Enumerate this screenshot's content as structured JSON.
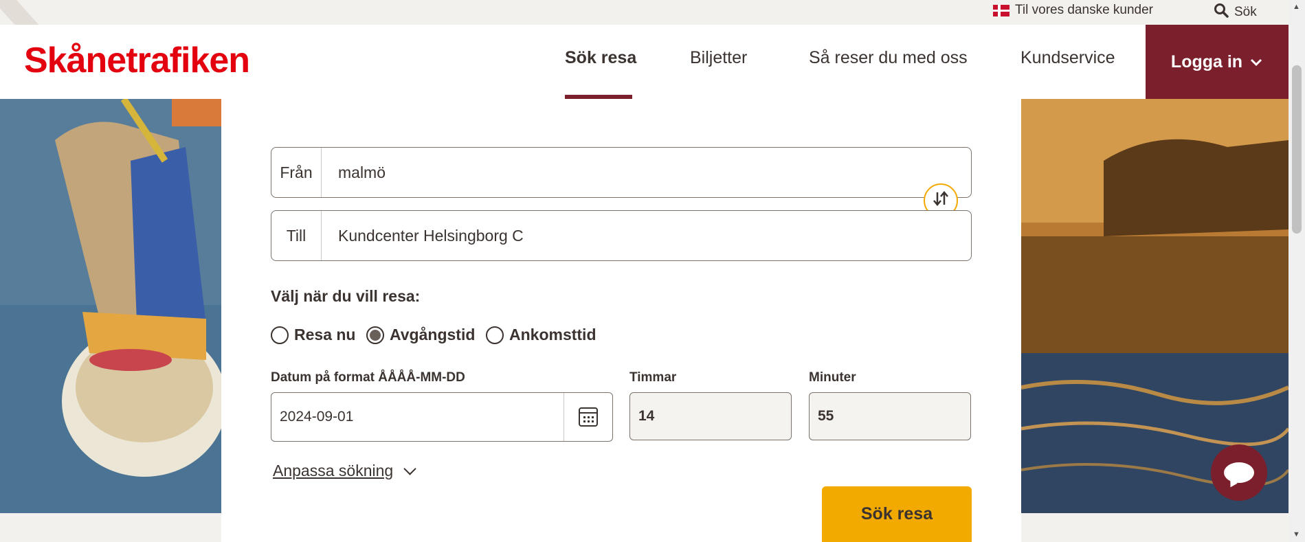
{
  "utility_bar": {
    "danish_customers": "Til vores danske kunder",
    "search": "Sök"
  },
  "header": {
    "logo": "Skånetrafiken",
    "nav": [
      {
        "label": "Sök resa",
        "active": true
      },
      {
        "label": "Biljetter",
        "active": false
      },
      {
        "label": "Så reser du med oss",
        "active": false
      },
      {
        "label": "Kundservice",
        "active": false
      }
    ],
    "login": "Logga in"
  },
  "form": {
    "from": {
      "label": "Från",
      "value": "malmö"
    },
    "to": {
      "label": "Till",
      "value": "Kundcenter Helsingborg C"
    },
    "when_label": "Välj när du vill resa:",
    "radios": [
      {
        "label": "Resa nu",
        "checked": false
      },
      {
        "label": "Avgångstid",
        "checked": true
      },
      {
        "label": "Ankomsttid",
        "checked": false
      }
    ],
    "date": {
      "label": "Datum på format ÅÅÅÅ-MM-DD",
      "value": "2024-09-01"
    },
    "hours": {
      "label": "Timmar",
      "value": "14"
    },
    "minutes": {
      "label": "Minuter",
      "value": "55"
    },
    "customize": "Anpassa sökning",
    "submit": "Sök resa"
  },
  "colors": {
    "brand_red": "#e3000f",
    "accent_burgundy": "#7a1f2b",
    "button_yellow": "#f2a900"
  },
  "icons": [
    "danish-flag-icon",
    "search-icon",
    "chevron-down-icon",
    "swap-icon",
    "calendar-icon",
    "chat-icon"
  ]
}
